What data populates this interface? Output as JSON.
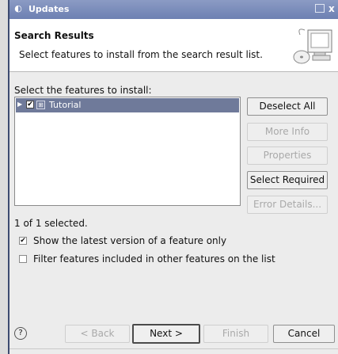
{
  "window": {
    "title": "Updates",
    "app_icon": "eclipse-icon",
    "close_glyph": "x"
  },
  "banner": {
    "heading": "Search Results",
    "description": "Select features to install from the search result list."
  },
  "features": {
    "label": "Select the features to install:",
    "items": [
      {
        "name": "Tutorial",
        "checked": true,
        "check_glyph": "✔",
        "icon": "feature-icon"
      }
    ],
    "selected_summary": "1 of 1 selected."
  },
  "side_buttons": {
    "deselect_all": "Deselect All",
    "more_info": "More Info",
    "properties": "Properties",
    "select_required": "Select Required",
    "error_details": "Error Details..."
  },
  "options": {
    "latest_version": {
      "label": "Show the latest version of a feature only",
      "checked": true,
      "check_glyph": "✔"
    },
    "filter_included": {
      "label": "Filter features included in other features on the list",
      "checked": false
    }
  },
  "footer": {
    "help_glyph": "?",
    "back": "< Back",
    "next": "Next >",
    "finish": "Finish",
    "cancel": "Cancel"
  }
}
